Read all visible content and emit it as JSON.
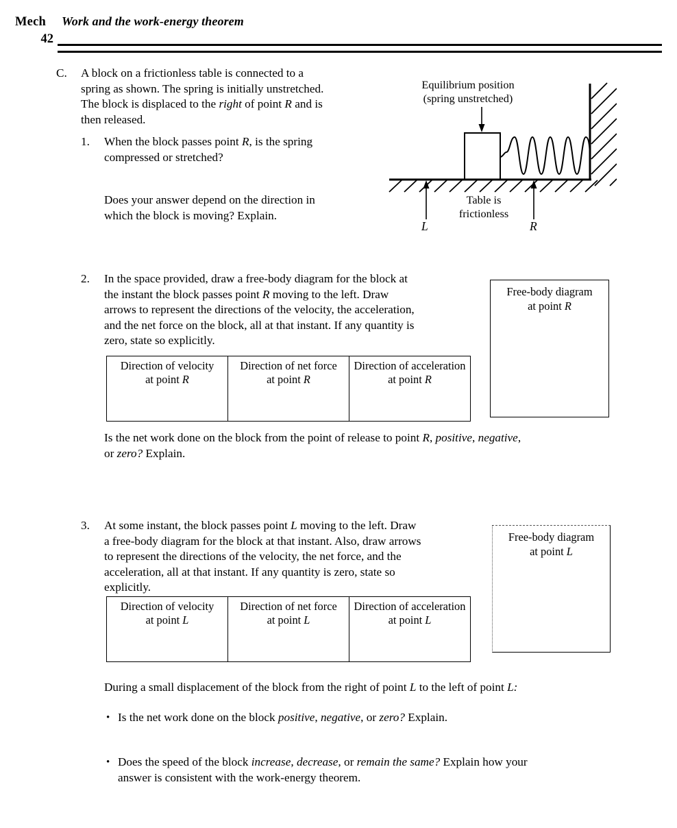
{
  "header": {
    "course": "Mech",
    "page_number": "42",
    "title": "Work and the work-energy theorem"
  },
  "sections": {
    "c": {
      "marker": "C.",
      "intro_line1": "A block on a frictionless table is connected to a",
      "intro_line2": "spring as shown.  The spring is initially unstretched.",
      "intro_line3_a": "The block is displaced to the ",
      "intro_line3_i": "right",
      "intro_line3_b": " of point ",
      "intro_line3_i2": "R",
      "intro_line3_c": " and is",
      "intro_line4": "then released."
    },
    "item1": {
      "marker": "1.",
      "line1_a": "When the block passes point ",
      "line1_i": "R",
      "line1_b": ", is the spring",
      "line2": "compressed or stretched?",
      "line3": "Does your answer depend on the direction in",
      "line4": "which the block is moving?  Explain."
    },
    "item2": {
      "marker": "2.",
      "line1": "In the space provided, draw a free-body diagram for the block at",
      "line2_a": "the instant the block passes point ",
      "line2_i": "R",
      "line2_b": " moving to the left.  Draw",
      "line3": "arrows to represent the directions of the velocity, the acceleration,",
      "line4": "and the net force on the block, all at that instant.  If any quantity is",
      "line5": "zero, state so explicitly.",
      "followup_a": "Is the net work done on the block from the point of release to point ",
      "followup_i1": "R",
      "followup_b": ", ",
      "followup_i2": "positive",
      "followup_c": ", ",
      "followup_i3": "negative",
      "followup_d": ",",
      "followup_line2_a": "or ",
      "followup_line2_i": "zero?",
      "followup_line2_b": "  Explain."
    },
    "item3": {
      "marker": "3.",
      "line1_a": "At some instant, the block passes point ",
      "line1_i": "L",
      "line1_b": " moving to the left.  Draw",
      "line2": "a free-body diagram for the block at that instant. Also, draw arrows",
      "line3": "to represent the directions of the velocity, the net force, and the",
      "line4": "acceleration, all at that instant.  If any quantity is zero, state so",
      "line5": "explicitly.",
      "closing_a": "During a small displacement of the block from the right of point ",
      "closing_i1": "L",
      "closing_b": " to the left of point ",
      "closing_i2": "L:",
      "bullet1_a": "Is the net work done on the block ",
      "bullet1_i1": "positive",
      "bullet1_b": ", ",
      "bullet1_i2": "negative",
      "bullet1_c": ", or ",
      "bullet1_i3": "zero?",
      "bullet1_d": "  Explain.",
      "bullet2_a": "Does the speed of the block ",
      "bullet2_i1": "increase",
      "bullet2_b": ", ",
      "bullet2_i2": "decrease",
      "bullet2_c": ", or ",
      "bullet2_i3": "remain the same?",
      "bullet2_d": "  Explain how your",
      "bullet2_line2": "answer is consistent with the work-energy theorem.",
      "bullet_glyph": "•"
    }
  },
  "figure": {
    "caption_line1": "Equilibrium position",
    "caption_line2": "(spring unstretched)",
    "table_label_line1": "Table is",
    "table_label_line2": "frictionless",
    "point_left": "L",
    "point_right": "R",
    "spring_coils": 8
  },
  "tables": {
    "table_r": {
      "columns": [
        {
          "line1": "Direction of velocity",
          "line2_text": "at point ",
          "line2_italic": "R"
        },
        {
          "line1": "Direction of net force",
          "line2_text": "at point ",
          "line2_italic": "R"
        },
        {
          "line1": "Direction of acceleration",
          "line2_text": "at point ",
          "line2_italic": "R"
        }
      ]
    },
    "table_l": {
      "columns": [
        {
          "line1": "Direction of velocity",
          "line2_text": "at point ",
          "line2_italic": "L"
        },
        {
          "line1": "Direction of net force",
          "line2_text": "at point ",
          "line2_italic": "L"
        },
        {
          "line1": "Direction of acceleration",
          "line2_text": "at point ",
          "line2_italic": "L"
        }
      ]
    }
  },
  "fbd_boxes": {
    "r": {
      "line1": "Free-body diagram",
      "line2_text": "at point ",
      "line2_italic": "R"
    },
    "l": {
      "line1": "Free-body diagram",
      "line2_text": "at point ",
      "line2_italic": "L"
    }
  },
  "colors": {
    "ink": "#000000",
    "paper": "#ffffff",
    "faint_rule": "#555555"
  }
}
